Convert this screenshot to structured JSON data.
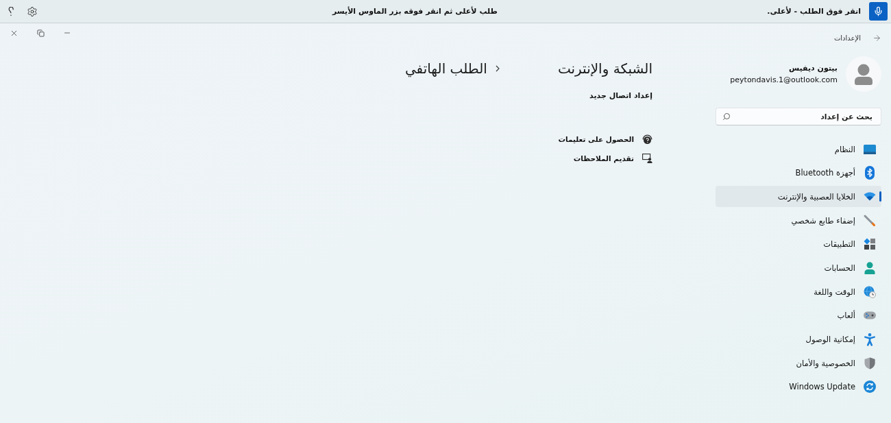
{
  "voice_bar": {
    "status": "انقر فوق الطلب - لأعلى.",
    "hint": "طلب لأعلى ثم انقر فوقه بزر الماوس الأيسر"
  },
  "window": {
    "title": "الإعدادات"
  },
  "profile": {
    "name": "بيتون ديفيس",
    "email": "peytondavis.1@outlook.com"
  },
  "search": {
    "placeholder": "بحث عن إعداد"
  },
  "sidebar": {
    "items": [
      {
        "kind": "system",
        "label": "النظام",
        "selected": false
      },
      {
        "kind": "bluetooth",
        "label": "أجهزة Bluetooth",
        "selected": false
      },
      {
        "kind": "network",
        "label": "الخلايا العصبية والإنترنت",
        "selected": true
      },
      {
        "kind": "personalization",
        "label": "إضفاء طابع شخصي",
        "selected": false
      },
      {
        "kind": "apps",
        "label": "التطبيقات",
        "selected": false
      },
      {
        "kind": "accounts",
        "label": "الحسابات",
        "selected": false
      },
      {
        "kind": "time",
        "label": "الوقت واللغة",
        "selected": false
      },
      {
        "kind": "gaming",
        "label": "ألعاب",
        "selected": false
      },
      {
        "kind": "accessibility",
        "label": "إمكانية الوصول",
        "selected": false
      },
      {
        "kind": "privacy",
        "label": "الخصوصية والأمان",
        "selected": false
      },
      {
        "kind": "update",
        "label": "Windows Update",
        "selected": false
      }
    ]
  },
  "breadcrumb": [
    "الشبكة والإنترنت",
    "الطلب الهاتفي"
  ],
  "content": {
    "link": "إعداد اتصال جديد"
  },
  "help_links": [
    {
      "kind": "help",
      "label": "الحصول على تعليمات"
    },
    {
      "kind": "feedback",
      "label": "تقديم الملاحظات"
    }
  ]
}
